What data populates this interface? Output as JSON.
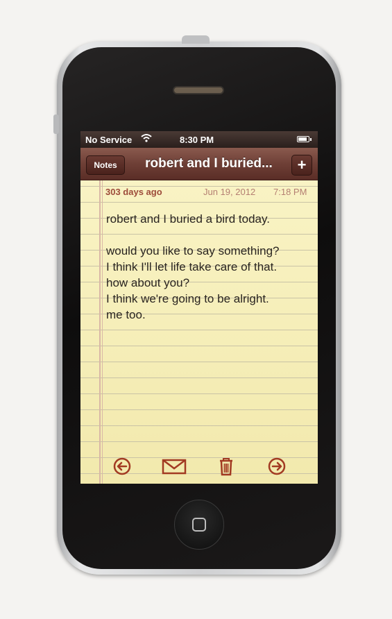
{
  "status_bar": {
    "carrier": "No Service",
    "time": "8:30 PM",
    "wifi_icon": "wifi-icon",
    "battery_icon": "battery-icon"
  },
  "nav": {
    "back_label": "Notes",
    "title": "robert and I buried...",
    "add_label": "+"
  },
  "note": {
    "age": "303 days ago",
    "date": "Jun 19, 2012",
    "time": "7:18 PM",
    "lines": [
      "robert and I buried a bird today.",
      "",
      "would you like to say something?",
      "I think I'll let life take care of that.",
      "how about you?",
      "I think we're going to be alright.",
      "me too."
    ]
  },
  "toolbar": {
    "icons": [
      "previous-arrow-icon",
      "mail-icon",
      "trash-icon",
      "next-arrow-icon"
    ]
  },
  "colors": {
    "paper": "#f7f0b5",
    "accent": "#a23a22",
    "nav_bar": "#6e3f36"
  }
}
